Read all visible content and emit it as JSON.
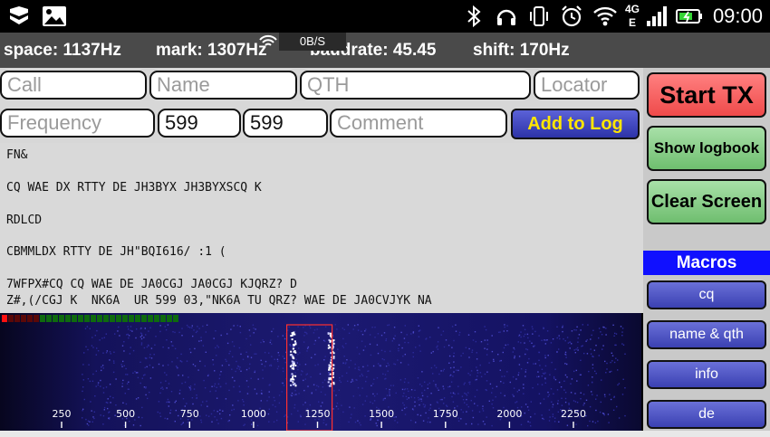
{
  "status": {
    "time": "09:00",
    "speed": "0B/S",
    "network": "4G"
  },
  "info": {
    "space": "space: 1137Hz",
    "mark": "mark: 1307Hz",
    "baudrate": "baudrate: 45.45",
    "shift": "shift: 170Hz"
  },
  "form": {
    "call_placeholder": "Call",
    "name_placeholder": "Name",
    "qth_placeholder": "QTH",
    "locator_placeholder": "Locator",
    "frequency_placeholder": "Frequency",
    "rst_sent": "599",
    "rst_rcvd": "599",
    "comment_placeholder": "Comment",
    "add_to_log": "Add to Log"
  },
  "received_text": [
    "FN&",
    "CQ WAE DX RTTY DE JH3BYX JH3BYXSCQ K",
    "RDLCD",
    "CBMMLDX RTTY DE JH\"BQI616/ :1 (",
    "7WFPX#CQ CQ WAE DE JA0CGJ JA0CGJ KJQRZ? D",
    "Z#,(/CGJ K  NK6A  UR 599 03,\"NK6A TU QRZ? WAE DE JA0CVJYK NA"
  ],
  "waterfall": {
    "axis_labels": [
      "250",
      "500",
      "750",
      "1000",
      "1250",
      "1500",
      "1750",
      "2000",
      "2250"
    ],
    "axis_values": [
      250,
      500,
      750,
      1000,
      1250,
      1500,
      1750,
      2000,
      2250
    ],
    "marker_low_hz": 1137,
    "marker_high_hz": 1307,
    "signal_level": 0.5
  },
  "right_panel": {
    "start_tx": "Start TX",
    "show_logbook": "Show logbook",
    "clear_screen": "Clear Screen",
    "macros_header": "Macros",
    "macros": [
      "cq",
      "name & qth",
      "info",
      "de"
    ]
  },
  "colors": {
    "marker": "#ff3030",
    "macros_header": "#1010ff",
    "add_log_text": "#ffe600"
  }
}
